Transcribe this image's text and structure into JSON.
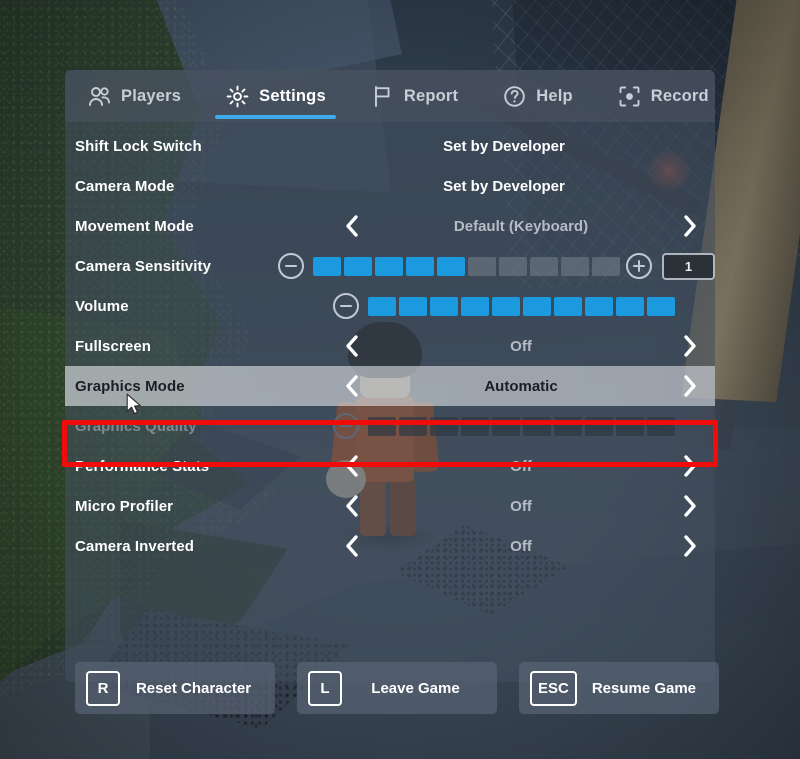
{
  "tabs": [
    {
      "id": "players",
      "label": "Players",
      "icon": "players-icon",
      "active": false
    },
    {
      "id": "settings",
      "label": "Settings",
      "icon": "gear-icon",
      "active": true
    },
    {
      "id": "report",
      "label": "Report",
      "icon": "flag-icon",
      "active": false
    },
    {
      "id": "help",
      "label": "Help",
      "icon": "question-icon",
      "active": false
    },
    {
      "id": "record",
      "label": "Record",
      "icon": "record-icon",
      "active": false
    }
  ],
  "rows": [
    {
      "id": "shift-lock-switch",
      "label": "Shift Lock Switch",
      "type": "static",
      "value": "Set by Developer"
    },
    {
      "id": "camera-mode",
      "label": "Camera Mode",
      "type": "static",
      "value": "Set by Developer"
    },
    {
      "id": "movement-mode",
      "label": "Movement Mode",
      "type": "selector",
      "value": "Default (Keyboard)",
      "muted": true
    },
    {
      "id": "camera-sensitivity",
      "label": "Camera Sensitivity",
      "type": "slider",
      "value": "1",
      "segments_total": 10,
      "segments_filled": 5,
      "has_plus": true,
      "has_numbox": true
    },
    {
      "id": "volume",
      "label": "Volume",
      "type": "slider",
      "value": "10",
      "segments_total": 10,
      "segments_filled": 10,
      "has_plus": false,
      "has_numbox": false
    },
    {
      "id": "fullscreen",
      "label": "Fullscreen",
      "type": "selector",
      "value": "Off"
    },
    {
      "id": "graphics-mode",
      "label": "Graphics Mode",
      "type": "selector",
      "value": "Automatic",
      "highlighted": true
    },
    {
      "id": "graphics-quality",
      "label": "Graphics Quality",
      "type": "slider",
      "value": "",
      "segments_total": 10,
      "segments_filled": 0,
      "has_plus": false,
      "has_numbox": false,
      "disabled": true
    },
    {
      "id": "performance-stats",
      "label": "Performance Stats",
      "type": "selector",
      "value": "Off"
    },
    {
      "id": "micro-profiler",
      "label": "Micro Profiler",
      "type": "selector",
      "value": "Off"
    },
    {
      "id": "camera-inverted",
      "label": "Camera Inverted",
      "type": "selector",
      "value": "Off"
    }
  ],
  "buttons": [
    {
      "id": "reset-character",
      "key": "R",
      "label": "Reset Character"
    },
    {
      "id": "leave-game",
      "key": "L",
      "label": "Leave Game"
    },
    {
      "id": "resume-game",
      "key": "ESC",
      "label": "Resume Game"
    }
  ],
  "colors": {
    "accent_blue": "#3fabeb",
    "slider_blue": "#1b9ae0",
    "highlight_red": "#f10c0c",
    "panel_bg": "#44505f",
    "text_white": "#ffffff"
  }
}
